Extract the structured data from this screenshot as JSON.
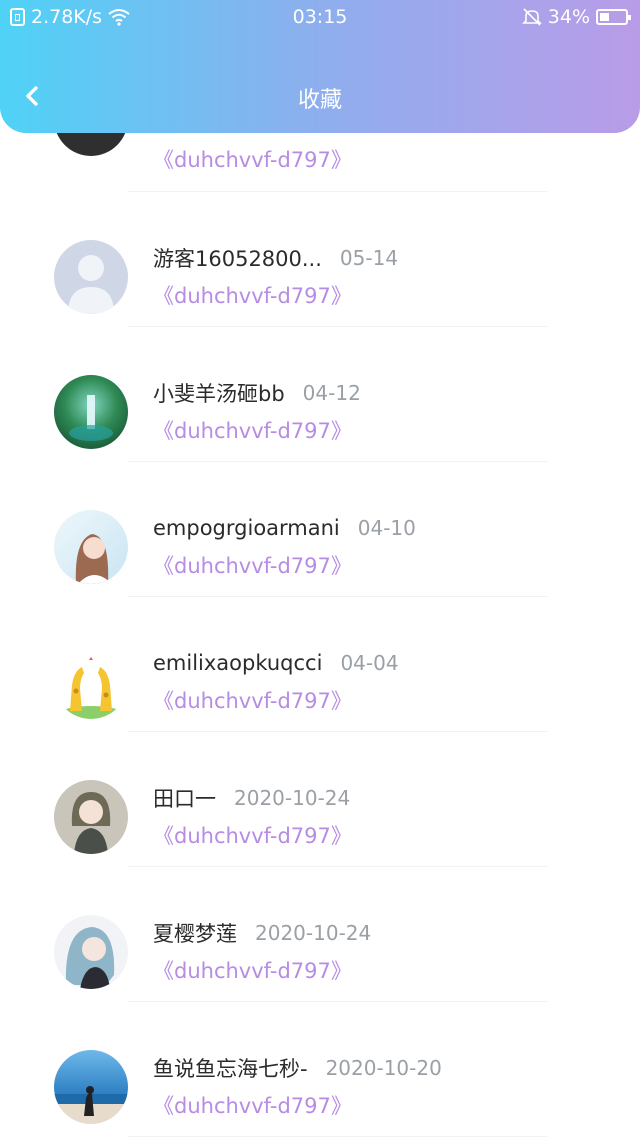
{
  "status_bar": {
    "speed": "2.78K/s",
    "time": "03:15",
    "battery": "34%"
  },
  "header": {
    "title": "收藏"
  },
  "favorites": [
    {
      "name": "",
      "date": "",
      "work": "《duhchvvf-d797》",
      "avatar_color": "#2b2b2b"
    },
    {
      "name": "游客16052800...",
      "date": "05-14",
      "work": "《duhchvvf-d797》",
      "avatar_color": "#cfd6e6"
    },
    {
      "name": "小斐羊汤砸bb",
      "date": "04-12",
      "work": "《duhchvvf-d797》",
      "avatar_color": "#2f8a55"
    },
    {
      "name": "empogrgioarmani",
      "date": "04-10",
      "work": "《duhchvvf-d797》",
      "avatar_color": "#d7ecf7"
    },
    {
      "name": "emilixaopkuqcci",
      "date": "04-04",
      "work": "《duhchvvf-d797》",
      "avatar_color": "#f3e7a5"
    },
    {
      "name": "田口一",
      "date": "2020-10-24",
      "work": "《duhchvvf-d797》",
      "avatar_color": "#b8b3a7"
    },
    {
      "name": "夏樱梦莲",
      "date": "2020-10-24",
      "work": "《duhchvvf-d797》",
      "avatar_color": "#9fb0c6"
    },
    {
      "name": "鱼说鱼忘海七秒-",
      "date": "2020-10-20",
      "work": "《duhchvvf-d797》",
      "avatar_color": "#4d9ad0"
    }
  ]
}
